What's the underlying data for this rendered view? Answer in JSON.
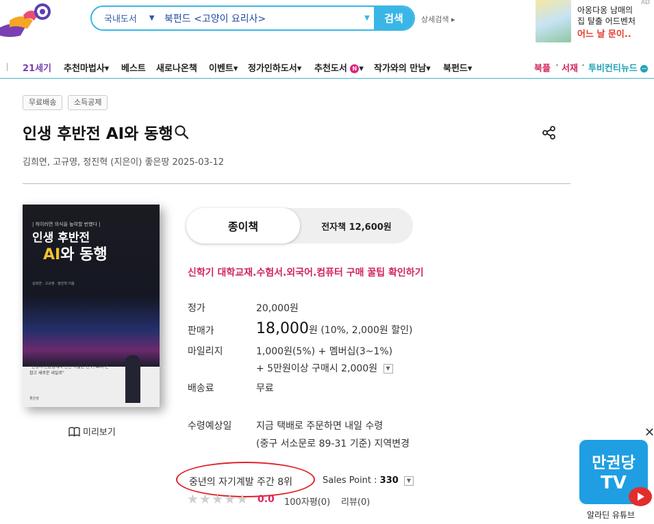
{
  "header": {
    "search": {
      "category": "국내도서",
      "query": "북펀드 <고양이 요리사>",
      "button_label": "검색"
    },
    "detail_search_label": "상세검색 ▸",
    "ad": {
      "label": "AD",
      "line1": "아옹다옹 남매의",
      "line2": "집 탈출 어드벤처",
      "line3": "어느 날 문이.."
    }
  },
  "nav": {
    "items": [
      "21세기",
      "추천마법사▾",
      "베스트",
      "새로나온책",
      "이벤트▾",
      "정가인하도서▾",
      "추천도서",
      "작가와의 만남▾",
      "북펀드▾"
    ],
    "new_badge": "N",
    "right_items": [
      "북플",
      "서재",
      "투비컨티뉴드"
    ],
    "right_sep": "·"
  },
  "product": {
    "tags": [
      "무료배송",
      "소득공제"
    ],
    "title": "인생 후반전 AI와 동행",
    "author_line": "김희연,  고규영,  정진혁 (지은이)   좋은땅   2025-03-12",
    "preview_label": "미리보기",
    "cover": {
      "subtitle": "| 하이러면 의식을 높여할 번했다 |",
      "title_line1": "인생 후반전",
      "title_ai": "AI",
      "title_line2_rest": "와 동행",
      "authors": "김희연 · 고규영 · 정진혁 지음",
      "quote": "\"인생의 전환점에서 만난 특별한 친구, AI와 손잡고 새로운 내일로\"",
      "publisher": "좋은땅"
    }
  },
  "format_tabs": {
    "paper": "종이책",
    "ebook": "전자책 12,600원"
  },
  "promo_link": "신학기 대학교재.수험서.외국어.컴퓨터 구매 꿀팁 확인하기",
  "pricing": {
    "list_price_label": "정가",
    "list_price": "20,000원",
    "sale_price_label": "판매가",
    "sale_price_num": "18,000",
    "sale_price_unit": "원",
    "sale_price_note": " (10%, 2,000원 할인)",
    "mileage_label": "마일리지",
    "mileage": "1,000원(5%) + 멤버십(3~1%)",
    "mileage_extra": "+ 5만원이상 구매시 2,000원",
    "shipping_label": "배송료",
    "shipping": "무료",
    "delivery_label": "수령예상일",
    "delivery_line1": "지금 택배로 주문하면 내일 수령",
    "delivery_line2": "(중구 서소문로 89-31 기준) 지역변경"
  },
  "rank": {
    "text": "중년의 자기계발 주간 8위",
    "sales_point_label": "Sales Point : ",
    "sales_point_value": "330"
  },
  "rating": {
    "score": "0.0",
    "review_100": "100자평(0)",
    "reviews": "리뷰(0)"
  },
  "widget": {
    "line1": "만권당",
    "line2": "TV",
    "caption": "알라딘 유튜브"
  },
  "colors": {
    "brand_blue": "#3ab6e6",
    "accent_pink": "#d1245e",
    "nav_purple": "#7b3fb3",
    "rank_red": "#e0232b"
  }
}
